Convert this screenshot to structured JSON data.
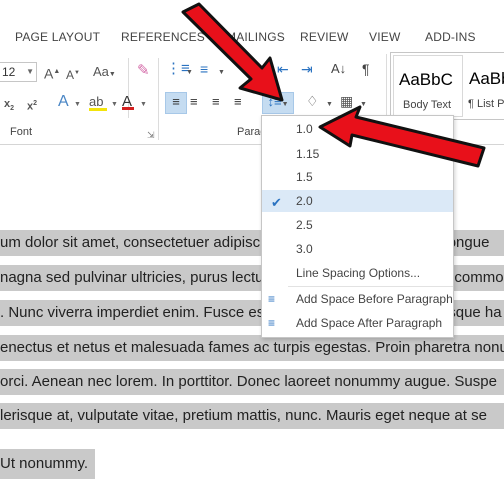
{
  "tabs": [
    "PAGE LAYOUT",
    "REFERENCES",
    "MAILINGS",
    "REVIEW",
    "VIEW",
    "ADD-INS"
  ],
  "font": {
    "size_value": "12",
    "group_label": "Font"
  },
  "paragraph": {
    "group_label": "Paragr"
  },
  "styles": {
    "style1_sample": "AaBbC",
    "style1_name": "Body Text",
    "style2_sample": "AaBb",
    "style2_name": "¶ List P"
  },
  "spacing_menu": {
    "options": [
      "1.0",
      "1.15",
      "1.5",
      "2.0",
      "2.5",
      "3.0"
    ],
    "checked": "2.0",
    "more_options": "Line Spacing Options...",
    "add_before": "Add Space Before Paragraph",
    "add_after": "Add Space After Paragraph"
  },
  "document": {
    "lines": [
      "um dolor sit amet, consectetuer adipiscing elit. Maecenas porttitor congue",
      "nagna sed pulvinar ultricies, purus lectus malesuada libero, sit amet commo",
      ". Nunc viverra imperdiet enim. Fusce est. Vivamus a tellus. Pellentesque ha",
      "enectus et netus et malesuada fames ac turpis egestas. Proin pharetra nonu",
      "orci. Aenean nec lorem. In porttitor. Donec laoreet nonummy augue. Suspe",
      "lerisque at, vulputate vitae, pretium mattis, nunc. Mauris eget neque at se",
      "Ut nonummy."
    ]
  },
  "colors": {
    "highlight": "#c9c9c9",
    "selected_button": "#c5dcf1",
    "arrow": "#e8101a",
    "check": "#2b73c1"
  }
}
